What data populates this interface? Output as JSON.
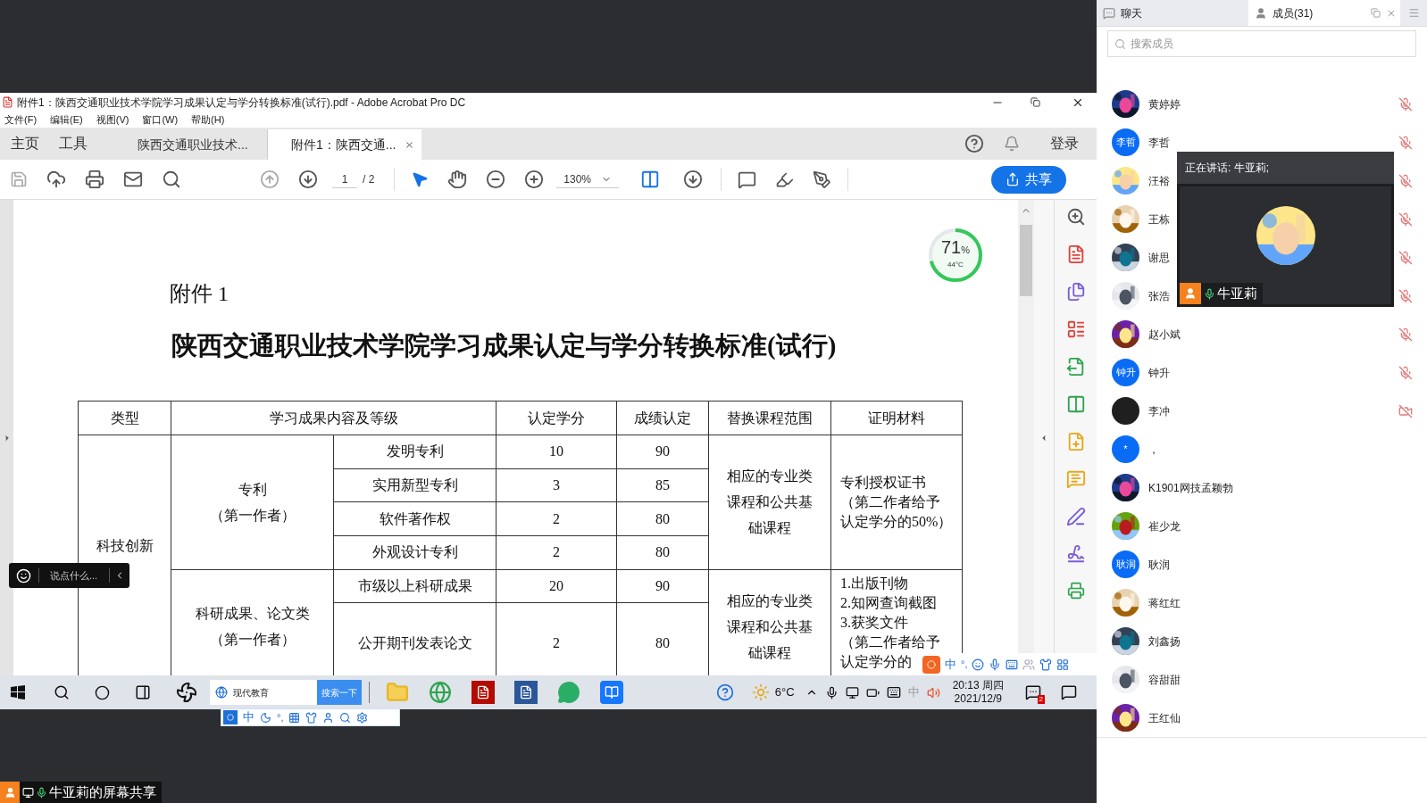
{
  "window": {
    "title": "附件1：陕西交通职业技术学院学习成果认定与学分转换标准(试行).pdf - Adobe Acrobat Pro DC"
  },
  "menu": [
    "文件(F)",
    "编辑(E)",
    "视图(V)",
    "窗口(W)",
    "帮助(H)"
  ],
  "nav": [
    "主页",
    "工具"
  ],
  "doc_tabs": [
    {
      "label": "陕西交通职业技术...",
      "selected": false
    },
    {
      "label": "附件1：陕西交通...",
      "selected": true
    }
  ],
  "sign_in": "登录",
  "toolbar": {
    "page": "1",
    "page_total": "/ 2",
    "zoom": "130%",
    "share": "共享"
  },
  "monitor": {
    "value": "71",
    "unit": "%",
    "temperature": "44°C",
    "level": 0.71
  },
  "document": {
    "heading": "附件 1",
    "title": "陕西交通职业技术学院学习成果认定与学分转换标准(试行)",
    "table": {
      "columns": [
        "类型",
        "学习成果内容及等级",
        "认定学分",
        "成绩认定",
        "替换课程范围",
        "证明材料"
      ],
      "category": "科技创新",
      "groups": [
        {
          "label": [
            "专利",
            "（第一作者）"
          ],
          "courses": "相应的专业类课程和公共基础课程",
          "evidence": [
            "专利授权证书（第二作者给予认定学分的50%）"
          ],
          "items": [
            {
              "name": "发明专利",
              "credits": "10",
              "score": "90"
            },
            {
              "name": "实用新型专利",
              "credits": "3",
              "score": "85"
            },
            {
              "name": "软件著作权",
              "credits": "2",
              "score": "80"
            },
            {
              "name": "外观设计专利",
              "credits": "2",
              "score": "80"
            }
          ]
        },
        {
          "label": [
            "科研成果、论文类",
            "（第一作者）"
          ],
          "courses": "相应的专业类课程和公共基础课程",
          "evidence": [
            "1.出版刊物",
            "2.知网查询截图",
            "3.获奖文件",
            "（第二作者给予",
            "认定学分的"
          ],
          "items": [
            {
              "name": "市级以上科研成果",
              "credits": "20",
              "score": "90"
            },
            {
              "name": "公开期刊发表论文",
              "credits": "2",
              "score": "80"
            }
          ]
        }
      ]
    }
  },
  "chat_bar": {
    "placeholder": "说点什么..."
  },
  "ime_bar": {
    "mode": "中",
    "punct": "°,"
  },
  "taskbar": {
    "search": "现代教育",
    "search_button": "搜索一下",
    "weather": "6°C",
    "ime": "中",
    "time": "20:13 周四",
    "date": "2021/12/9",
    "badge": "2"
  },
  "ime_bar_2": {
    "mode": "中",
    "punct": "°,"
  },
  "screen_share": "牛亚莉的屏幕共享",
  "panel": {
    "tabs": [
      {
        "label": "聊天",
        "selected": false
      },
      {
        "label": "成员(31)",
        "selected": true
      }
    ],
    "search": {
      "placeholder": "搜索成员"
    },
    "members": [
      {
        "name": "黄婷婷",
        "mic_muted": true,
        "camera_off": false
      },
      {
        "name": "李哲",
        "avatar": {
          "kind": "text",
          "text": "李哲"
        },
        "mic_muted": true,
        "camera_off": false
      },
      {
        "name": "汪裕",
        "mic_muted": true,
        "camera_off": false
      },
      {
        "name": "王栋",
        "mic_muted": true,
        "camera_off": false
      },
      {
        "name": "谢思",
        "mic_muted": true,
        "camera_off": false
      },
      {
        "name": "张浩",
        "mic_muted": true,
        "camera_off": false
      },
      {
        "name": "赵小斌",
        "mic_muted": true,
        "camera_off": false
      },
      {
        "name": "钟升",
        "avatar": {
          "kind": "text",
          "text": "钟升"
        },
        "mic_muted": true,
        "camera_off": false
      },
      {
        "name": "李冲",
        "avatar": {
          "kind": "plain"
        },
        "mic_muted": false,
        "camera_off": true
      },
      {
        "name": "，",
        "avatar": {
          "kind": "text",
          "text": "*"
        },
        "mic_muted": false,
        "camera_off": false
      },
      {
        "name": "K1901网技孟颖勃",
        "mic_muted": false,
        "camera_off": false
      },
      {
        "name": "崔少龙",
        "mic_muted": false,
        "camera_off": false
      },
      {
        "name": "耿润",
        "avatar": {
          "kind": "text",
          "text": "耿润"
        },
        "mic_muted": false,
        "camera_off": false
      },
      {
        "name": "蒋红红",
        "mic_muted": false,
        "camera_off": false
      },
      {
        "name": "刘鑫扬",
        "mic_muted": false,
        "camera_off": false
      },
      {
        "name": "容甜甜",
        "mic_muted": false,
        "camera_off": false
      },
      {
        "name": "王红仙",
        "mic_muted": false,
        "camera_off": false
      }
    ],
    "speaker": {
      "caption": "正在讲话: 牛亚莉;",
      "name": "牛亚莉"
    }
  }
}
